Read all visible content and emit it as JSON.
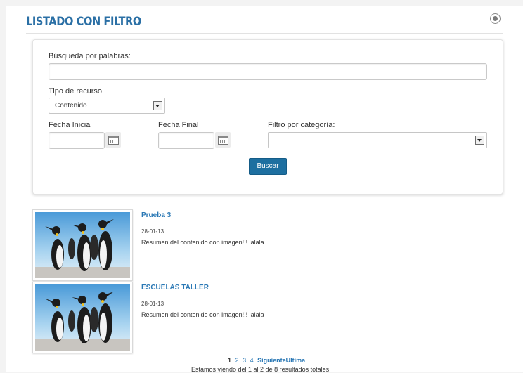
{
  "portlet": {
    "title": "LISTADO CON FILTRO",
    "options_icon": "options-icon"
  },
  "search": {
    "keywords_label": "Búsqueda por palabras:",
    "keywords_value": "",
    "resource_type_label": "Tipo de recurso",
    "resource_type_value": "Contenido",
    "start_date_label": "Fecha Inicial",
    "start_date_value": "",
    "end_date_label": "Fecha Final",
    "end_date_value": "",
    "category_label": "Filtro por categoría:",
    "category_value": "",
    "submit_label": "Buscar",
    "calendar_icon": "calendar-icon"
  },
  "results": [
    {
      "title": "Prueba 3",
      "date": "28-01-13",
      "summary": "Resumen del contenido con imagen!!! lalala",
      "image": "penguins-thumbnail"
    },
    {
      "title": "ESCUELAS TALLER",
      "date": "28-01-13",
      "summary": "Resumen del contenido con imagen!!! lalala",
      "image": "penguins-thumbnail"
    }
  ],
  "pagination": {
    "current": "1",
    "pages": [
      "2",
      "3",
      "4"
    ],
    "next_last": "SiguienteUltima",
    "info": "Estamos viendo del 1 al 2 de 8 resultados totales"
  },
  "colors": {
    "accent": "#2a6fa5",
    "button": "#1d6fa0",
    "link": "#2a78b5"
  }
}
